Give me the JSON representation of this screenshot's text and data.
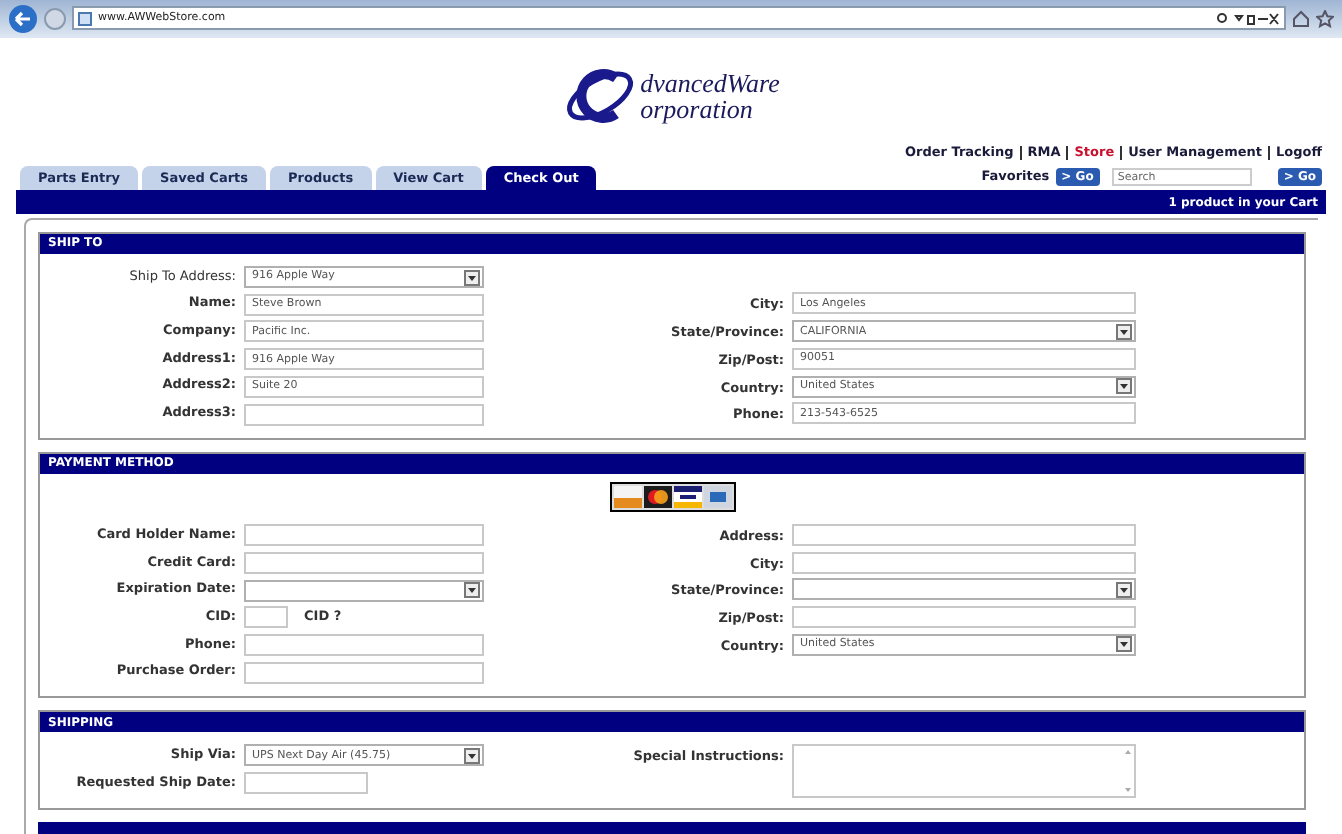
{
  "browser": {
    "url": "www.AWWebStore.com"
  },
  "logo": {
    "line_1": "dvancedWare",
    "line_2": "orporation"
  },
  "top_links": [
    {
      "label": "Order Tracking",
      "selected": false
    },
    {
      "label": "RMA",
      "selected": false
    },
    {
      "label": "Store",
      "selected": true
    },
    {
      "label": "User Management",
      "selected": false
    },
    {
      "label": "Logoff",
      "selected": false
    }
  ],
  "favorites": {
    "label": "Favorites",
    "button": "> Go"
  },
  "search": {
    "placeholder": "Search",
    "button": "> Go"
  },
  "tabs": [
    {
      "label": "Parts Entry",
      "selected": false
    },
    {
      "label": "Saved Carts",
      "selected": false
    },
    {
      "label": "Products",
      "selected": false
    },
    {
      "label": "View Cart",
      "selected": false
    },
    {
      "label": "Check Out",
      "selected": true
    }
  ],
  "cart_status": "1 product in your Cart",
  "sections": [
    {
      "title": "SHIP TO",
      "card_logos": false,
      "rows": [
        {
          "left": {
            "label": "Ship To Address:",
            "bold": false,
            "kind": "select",
            "value": "916 Apple Way"
          }
        },
        {
          "left": {
            "label": "Name:",
            "bold": true,
            "kind": "text",
            "value": "Steve Brown"
          },
          "right": {
            "label": "City:",
            "bold": true,
            "kind": "text",
            "value": "Los Angeles"
          }
        },
        {
          "left": {
            "label": "Company:",
            "bold": true,
            "kind": "text",
            "value": "Pacific Inc."
          },
          "right": {
            "label": "State/Province:",
            "bold": true,
            "kind": "select",
            "value": "CALIFORNIA"
          }
        },
        {
          "left": {
            "label": "Address1:",
            "bold": true,
            "kind": "text",
            "value": "916 Apple Way"
          },
          "right": {
            "label": "Zip/Post:",
            "bold": true,
            "kind": "text",
            "value": "90051"
          }
        },
        {
          "left": {
            "label": "Address2:",
            "bold": true,
            "kind": "text",
            "value": "Suite 20"
          },
          "right": {
            "label": "Country:",
            "bold": true,
            "kind": "select",
            "value": "United States"
          }
        },
        {
          "left": {
            "label": "Address3:",
            "bold": true,
            "kind": "text"
          },
          "right": {
            "label": "Phone:",
            "bold": true,
            "kind": "text",
            "value": "213-543-6525"
          }
        }
      ]
    },
    {
      "title": "PAYMENT METHOD",
      "card_logos": true,
      "rows": [
        {
          "left": {
            "label": "Card Holder Name:",
            "bold": true,
            "kind": "text"
          },
          "right": {
            "label": "Address:",
            "bold": true,
            "kind": "text"
          }
        },
        {
          "left": {
            "label": "Credit Card:",
            "bold": true,
            "kind": "text"
          },
          "right": {
            "label": "City:",
            "bold": true,
            "kind": "text"
          }
        },
        {
          "left": {
            "label": "Expiration Date:",
            "bold": true,
            "kind": "select"
          },
          "right": {
            "label": "State/Province:",
            "bold": true,
            "kind": "select"
          }
        },
        {
          "left": {
            "label": "CID:",
            "bold": true,
            "kind": "cid",
            "hint": "CID ?"
          },
          "right": {
            "label": "Zip/Post:",
            "bold": true,
            "kind": "text"
          }
        },
        {
          "left": {
            "label": "Phone:",
            "bold": true,
            "kind": "text"
          },
          "right": {
            "label": "Country:",
            "bold": true,
            "kind": "select",
            "value": "United States"
          }
        },
        {
          "left": {
            "label": "Purchase Order:",
            "bold": true,
            "kind": "text"
          }
        }
      ]
    },
    {
      "title": "SHIPPING",
      "card_logos": false,
      "rows": [
        {
          "left": {
            "label": "Ship Via:",
            "bold": true,
            "kind": "select",
            "value": "UPS Next Day Air (45.75)"
          },
          "right": {
            "label": "Special Instructions:",
            "bold": true,
            "kind": "textarea"
          }
        },
        {
          "left": {
            "label": "Requested Ship Date:",
            "bold": true,
            "kind": "short"
          }
        }
      ]
    }
  ]
}
